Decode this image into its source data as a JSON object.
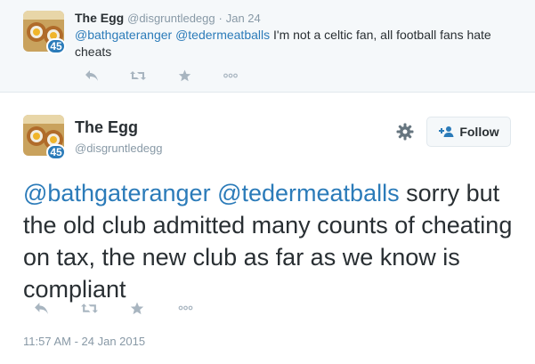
{
  "reply_tweet": {
    "name": "The Egg",
    "handle": "@disgruntledegg",
    "separator": "·",
    "date": "Jan 24",
    "mention_1": "@bathgateranger",
    "mention_2": "@tedermeatballs",
    "body": "I'm not a celtic fan, all football fans hate cheats",
    "avatar_badge": "45",
    "actions": [
      "reply-icon",
      "retweet-icon",
      "favorite-icon",
      "more-icon"
    ]
  },
  "main_tweet": {
    "name": "The Egg",
    "handle": "@disgruntledegg",
    "avatar_badge": "45",
    "follow_label": "Follow",
    "mention_1": "@bathgateranger",
    "mention_2": "@tedermeatballs",
    "body": "sorry but the old club admitted many counts of cheating on tax, the new club as far as we know is compliant",
    "timestamp": "11:57 AM - 24 Jan 2015",
    "actions": [
      "reply-icon",
      "retweet-icon",
      "favorite-icon",
      "more-icon"
    ]
  },
  "colors": {
    "link": "#2b7bb9",
    "muted": "#8899a6",
    "text": "#292f33",
    "reply_background": "#f5f8fa"
  }
}
